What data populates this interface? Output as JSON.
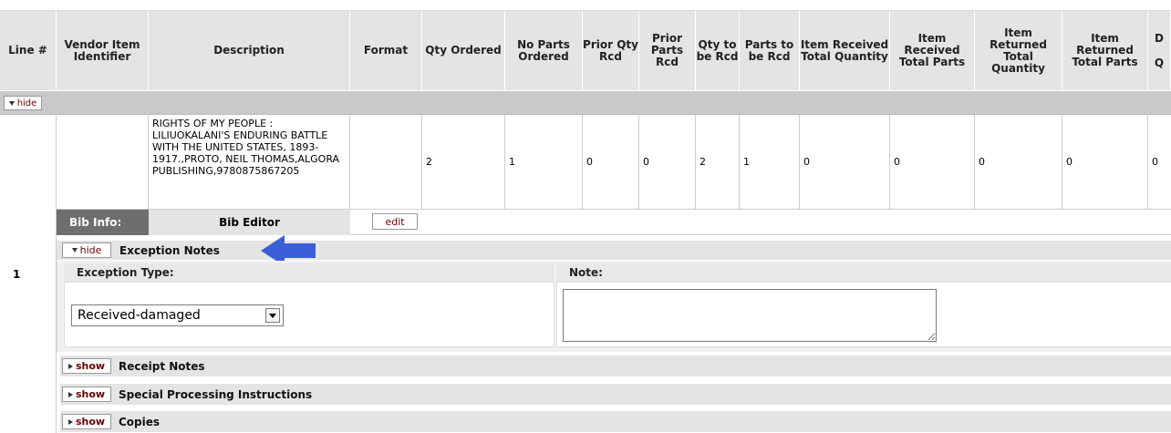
{
  "columns": [
    "Line #",
    "Vendor Item Identifier",
    "Description",
    "Format",
    "Qty Ordered",
    "No Parts Ordered",
    "Prior Qty Rcd",
    "Prior Parts Rcd",
    "Qty to be Rcd",
    "Parts to be Rcd",
    "Item Received Total Quantity",
    "Item Received Total Parts",
    "Item Returned Total Quantity",
    "Item Returned Total Parts",
    "D"
  ],
  "column_partial_extra": "Q",
  "section_toggle": "hide",
  "row": {
    "line": "1",
    "vendor_item_identifier": "",
    "description": "RIGHTS OF MY PEOPLE : LILIUOKALANI'S ENDURING BATTLE WITH THE UNITED STATES, 1893-1917.,PROTO, NEIL THOMAS,ALGORA PUBLISHING,9780875867205",
    "format": "",
    "qty_ordered": "2",
    "no_parts_ordered": "1",
    "prior_qty_rcd": "0",
    "prior_parts_rcd": "0",
    "qty_to_be_rcd": "2",
    "parts_to_be_rcd": "1",
    "item_received_total_quantity": "0",
    "item_received_total_parts": "0",
    "item_returned_total_quantity": "0",
    "item_returned_total_parts": "0",
    "last_partial": "0"
  },
  "bib": {
    "label": "Bib Info:",
    "editor_label": "Bib Editor",
    "edit_button": "edit"
  },
  "exception_notes": {
    "toggle": "hide",
    "title": "Exception Notes",
    "type_header": "Exception Type:",
    "note_header": "Note:",
    "selected_type": "Received-damaged",
    "note_value": ""
  },
  "collapsed_sections": [
    {
      "toggle": "show",
      "title": "Receipt Notes"
    },
    {
      "toggle": "show",
      "title": "Special Processing Instructions"
    },
    {
      "toggle": "show",
      "title": "Copies"
    }
  ],
  "colors": {
    "header_bg": "#e4e4e4",
    "button_text": "#6b0000",
    "arrow": "#3b5fd9"
  }
}
